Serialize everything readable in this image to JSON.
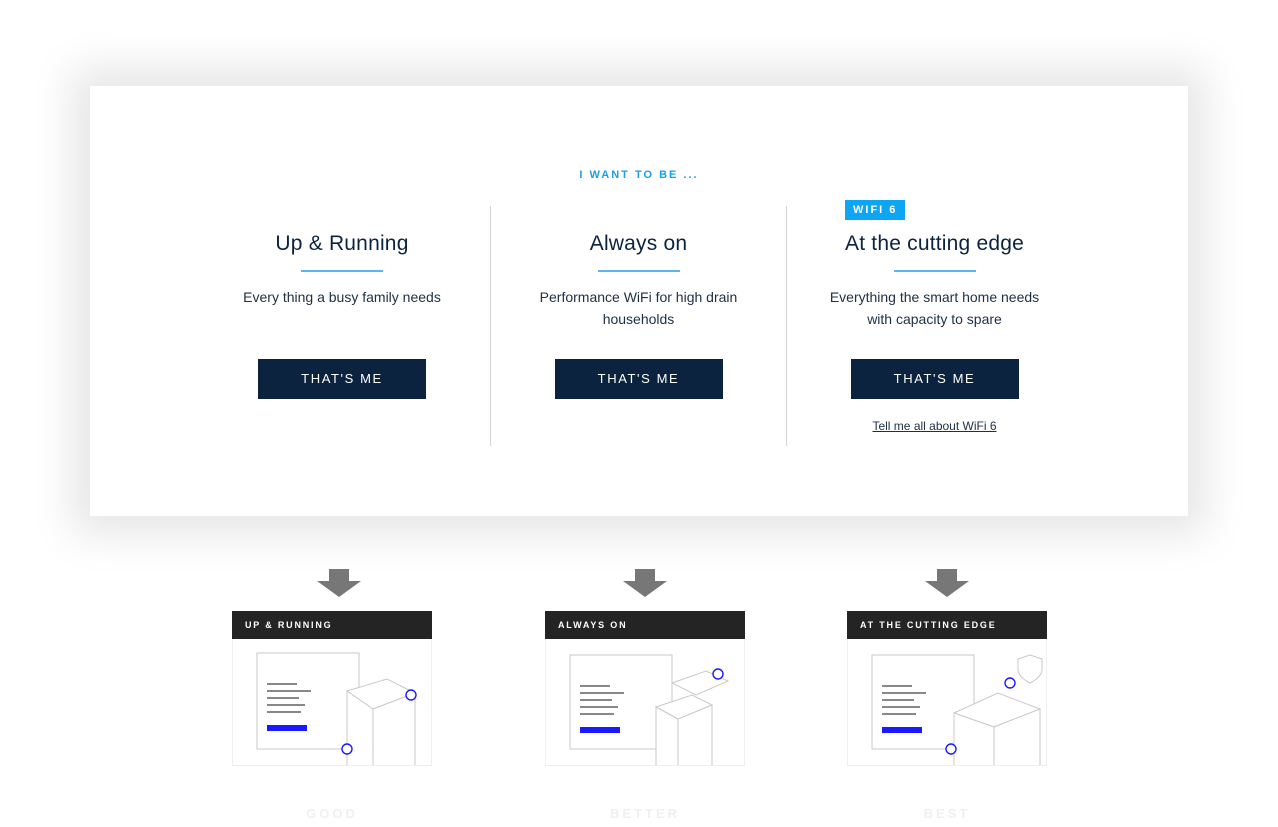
{
  "header": {
    "eyebrow": "I WANT TO BE ..."
  },
  "options": [
    {
      "title": "Up & Running",
      "description": "Every thing a busy family needs",
      "button": "THAT'S ME"
    },
    {
      "title": "Always on",
      "description": "Performance WiFi for high drain households",
      "button": "THAT'S ME"
    },
    {
      "title": "At the cutting edge",
      "description": "Everything the smart home needs with capacity to spare",
      "button": "THAT'S ME",
      "badge": "WIFI 6",
      "link": "Tell me all about WiFi 6"
    }
  ],
  "cards": [
    {
      "header": "UP & RUNNING",
      "tier": "GOOD"
    },
    {
      "header": "ALWAYS ON",
      "tier": "BETTER"
    },
    {
      "header": "AT THE CUTTING EDGE",
      "tier": "BEST"
    }
  ],
  "colors": {
    "navy": "#0c2340",
    "accent": "#0ea5f5",
    "underline": "#5ab4ee",
    "card_header": "#242424",
    "illustration_accent": "#1a1aff"
  },
  "icons": [
    "arrow-down-icon",
    "router-illustration",
    "shield-icon"
  ]
}
